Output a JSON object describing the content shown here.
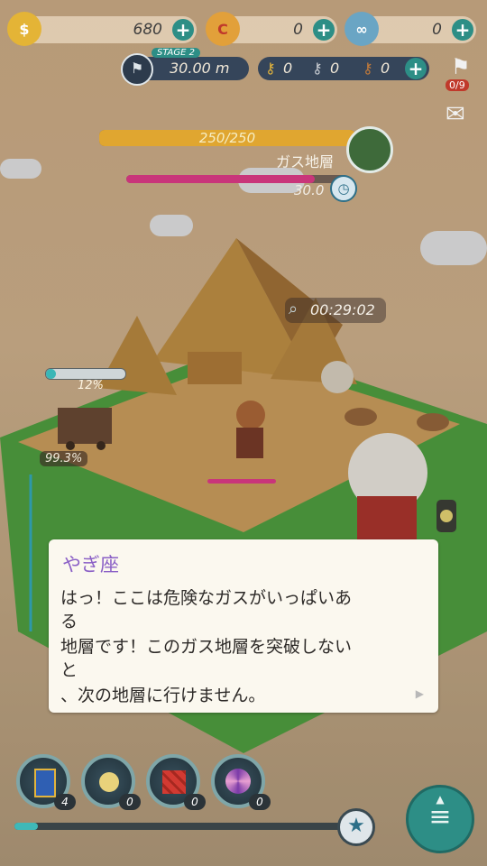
{
  "currencies": {
    "gold": {
      "value": "680",
      "icon": "gold-coin-icon"
    },
    "red": {
      "value": "0",
      "icon": "red-coin-icon"
    },
    "blue": {
      "value": "0",
      "icon": "blue-coin-icon"
    }
  },
  "stage": {
    "label": "STAGE 2",
    "depth": "30.00 m"
  },
  "keys": [
    {
      "icon": "gold-key-icon",
      "value": "0"
    },
    {
      "icon": "silver-key-icon",
      "value": "0"
    },
    {
      "icon": "bronze-key-icon",
      "value": "0"
    }
  ],
  "flag": {
    "count": "0/9"
  },
  "layer": {
    "hp": "250/250",
    "hp_fraction": 1.0,
    "name": "ガス地層",
    "timer_value": "30.0",
    "timer_fraction": 0.85
  },
  "mine_timer": "00:29:02",
  "cart": {
    "progress": "12%",
    "progress_fraction": 0.12,
    "efficiency": "99.3%"
  },
  "dialog": {
    "speaker": "やぎ座",
    "lines": [
      "はっ！ここは危険なガスがいっぱいあ",
      "る",
      "地層です！このガス地層を突破しない",
      "と",
      "、次の地層に行けません。"
    ]
  },
  "items": [
    {
      "icon": "card-pack-icon",
      "count": "4"
    },
    {
      "icon": "potion-icon",
      "count": "0"
    },
    {
      "icon": "dynamite-icon",
      "count": "0"
    },
    {
      "icon": "candy-icon",
      "count": "0"
    }
  ],
  "colors": {
    "accent": "#2d8e86",
    "hp_bar": "#e0a630",
    "timer_bar": "#c9357a",
    "name_text": "#8a5fc6"
  }
}
